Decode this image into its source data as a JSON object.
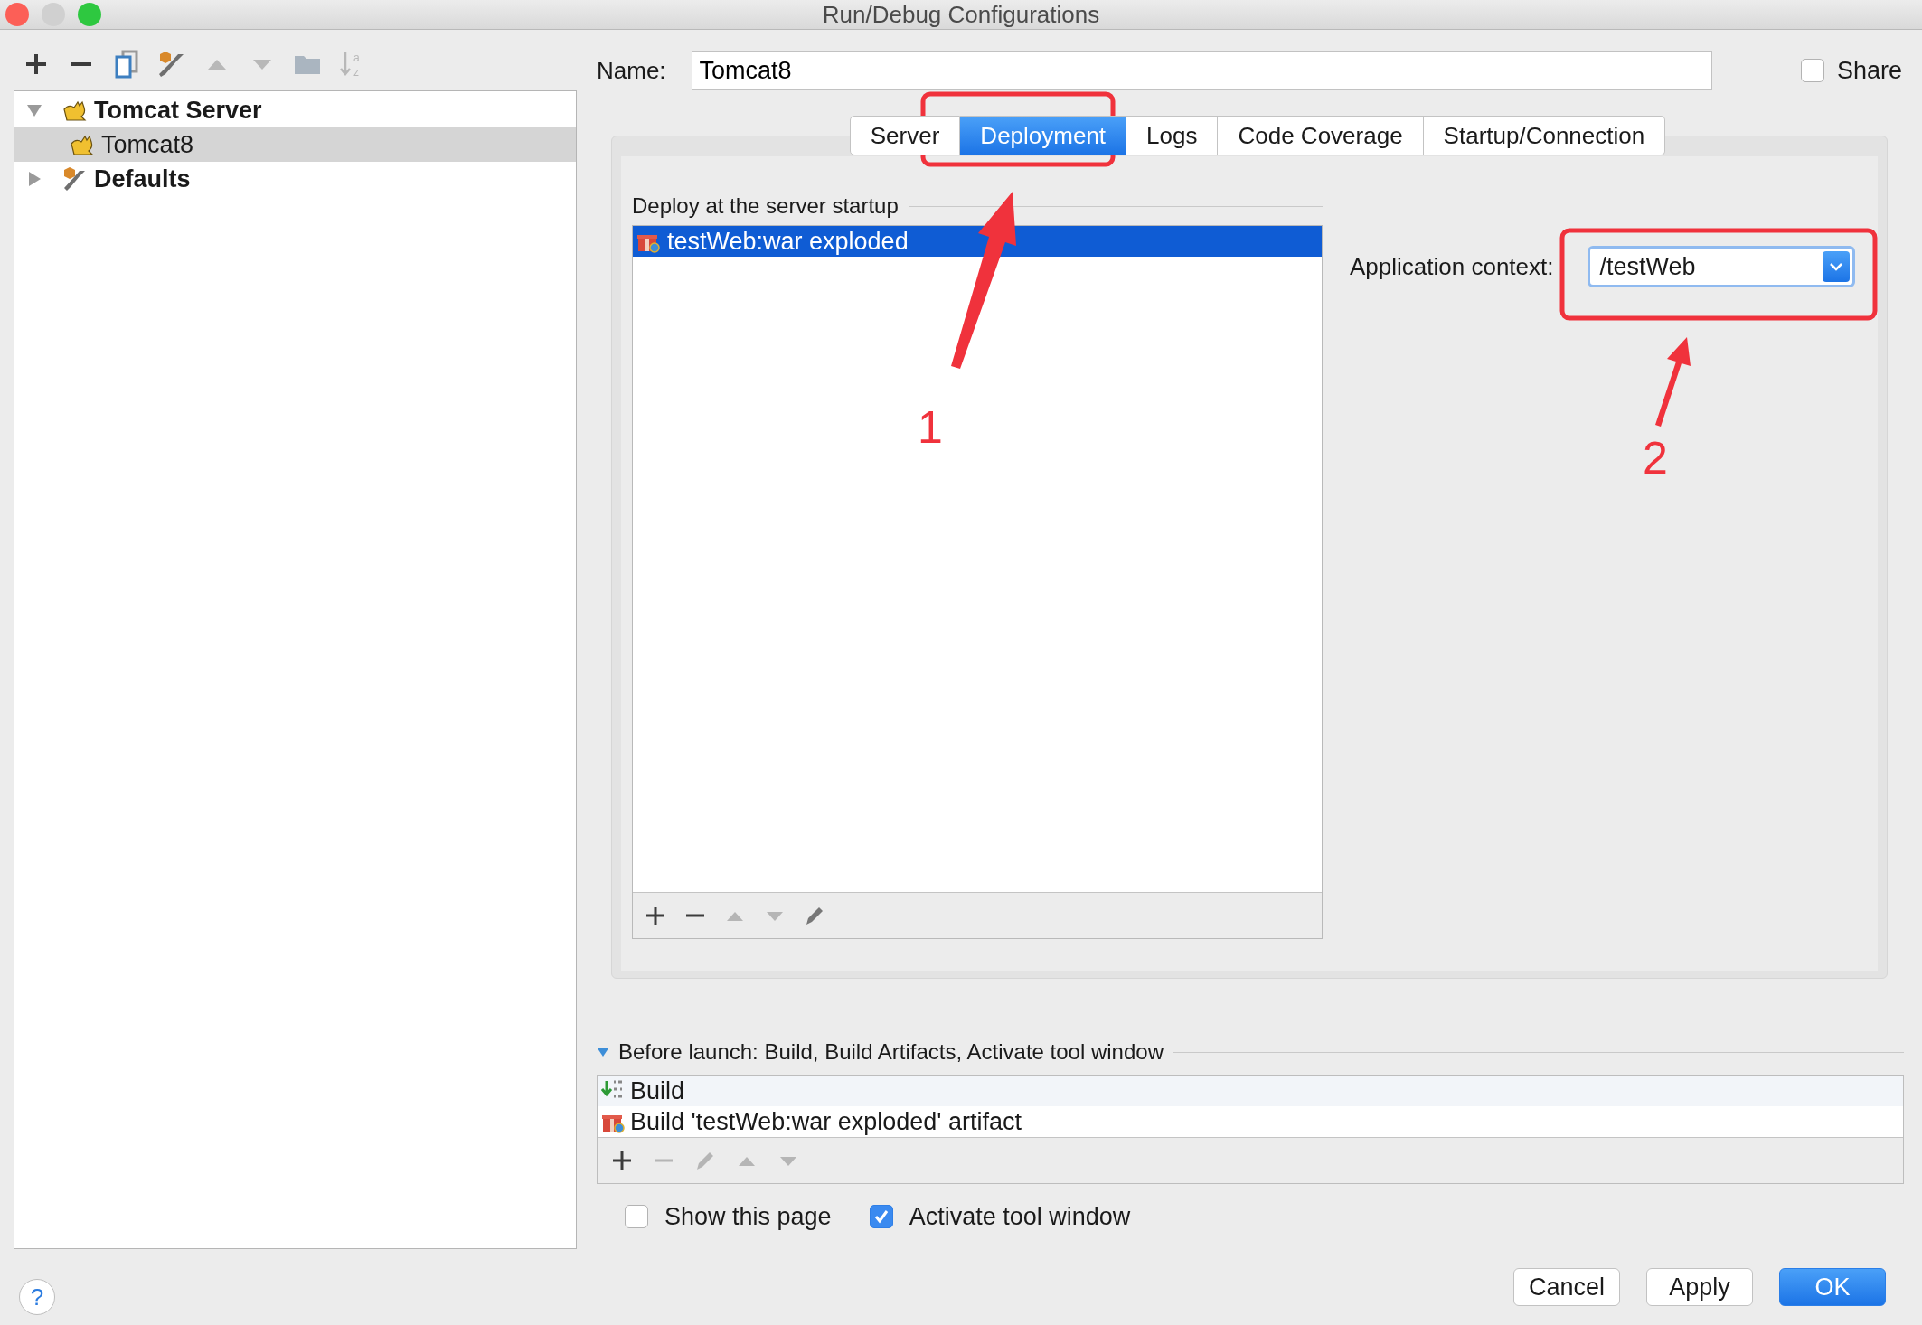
{
  "window": {
    "title": "Run/Debug Configurations"
  },
  "toolbar": [
    {
      "kind": "add",
      "disabled": false
    },
    {
      "kind": "remove",
      "disabled": false
    },
    {
      "kind": "copy",
      "disabled": false
    },
    {
      "kind": "settings",
      "disabled": false
    },
    {
      "kind": "up",
      "disabled": true
    },
    {
      "kind": "down",
      "disabled": true
    },
    {
      "kind": "folder",
      "disabled": true
    },
    {
      "kind": "sort",
      "disabled": true,
      "letters": [
        "a",
        "z"
      ]
    }
  ],
  "help": {
    "label": "?"
  },
  "tree": [
    {
      "label": "Tomcat Server",
      "kind": "tomcat",
      "expanded": true,
      "selected": false,
      "children": [
        {
          "label": "Tomcat8",
          "kind": "tomcat",
          "selected": true
        }
      ]
    },
    {
      "label": "Defaults",
      "kind": "defaults",
      "expanded": false,
      "selected": false
    }
  ],
  "name_field": {
    "label": "Name:",
    "value": "Tomcat8"
  },
  "share": {
    "label": "Share",
    "checked": false
  },
  "tabs": [
    {
      "label": "Server",
      "selected": false
    },
    {
      "label": "Deployment",
      "selected": true
    },
    {
      "label": "Logs",
      "selected": false
    },
    {
      "label": "Code Coverage",
      "selected": false
    },
    {
      "label": "Startup/Connection",
      "selected": false
    }
  ],
  "deployment": {
    "heading": "Deploy at the server startup",
    "items": [
      {
        "label": "testWeb:war exploded",
        "selected": true
      }
    ],
    "context_label": "Application context:",
    "context_value": "/testWeb"
  },
  "before_launch": {
    "heading": "Before launch: Build, Build Artifacts, Activate tool window",
    "expanded": true,
    "tasks": [
      {
        "kind": "build",
        "label": "Build"
      },
      {
        "kind": "artifact",
        "label": "Build 'testWeb:war exploded' artifact"
      }
    ]
  },
  "options": [
    {
      "label": "Show this page",
      "checked": false
    },
    {
      "label": "Activate tool window",
      "checked": true
    }
  ],
  "buttons": [
    {
      "label": "Cancel",
      "kind": "secondary"
    },
    {
      "label": "Apply",
      "kind": "secondary"
    },
    {
      "label": "OK",
      "kind": "primary"
    }
  ],
  "annotations": [
    {
      "label": "1"
    },
    {
      "label": "2"
    }
  ]
}
